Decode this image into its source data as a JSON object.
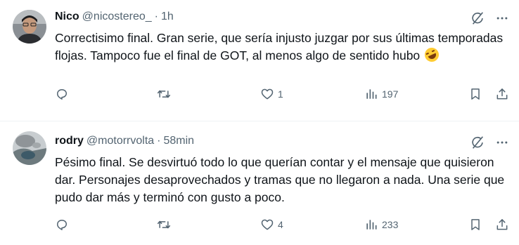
{
  "tweets": [
    {
      "name": "Nico",
      "handle": "@nicostereo_",
      "separator": "·",
      "time": "1h",
      "text": "Correctisimo final. Gran serie, que sería injusto juzgar por sus últimas temporadas flojas. Tampoco fue el final de GOT, al menos algo de sentido hubo ",
      "emoji": "rolling-on-floor-laughing",
      "replies": "",
      "retweets": "",
      "likes": "1",
      "views": "197"
    },
    {
      "name": "rodry",
      "handle": "@motorrvolta",
      "separator": "·",
      "time": "58min",
      "text": "Pésimo final. Se desvirtuó todo lo que querían contar y el mensaje que quisieron dar. Personajes desaprovechados y tramas que no llegaron a nada. Una serie que pudo dar más y terminó con gusto a poco.",
      "replies": "",
      "retweets": "",
      "likes": "4",
      "views": "233"
    }
  ],
  "colors": {
    "text": "#0f1419",
    "secondary": "#536471",
    "divider": "#eff3f4"
  },
  "icons": [
    "grok-icon",
    "more-icon",
    "reply-icon",
    "retweet-icon",
    "like-icon",
    "views-icon",
    "bookmark-icon",
    "share-icon"
  ]
}
